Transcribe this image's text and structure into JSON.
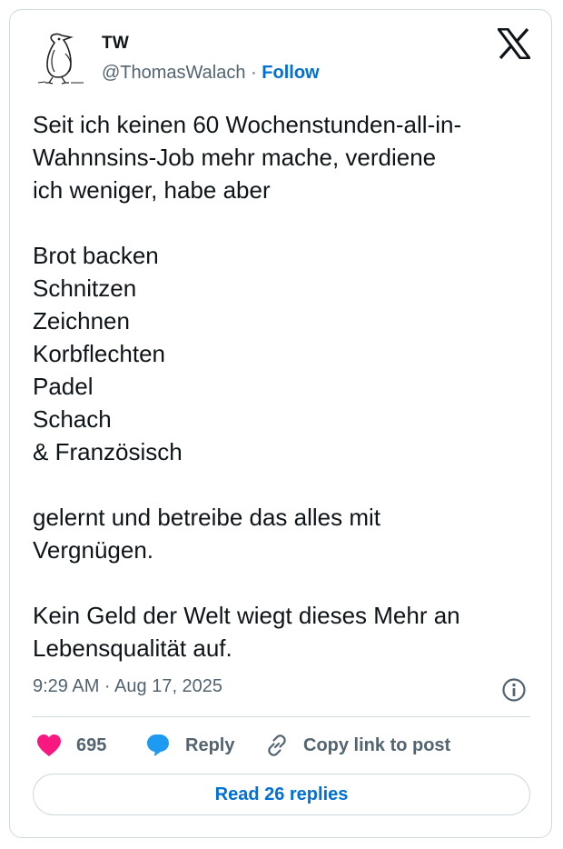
{
  "author": {
    "name": "TW",
    "handle": "@ThomasWalach",
    "separator": "·",
    "follow_label": "Follow",
    "avatar_icon": "penguin-sketch-avatar-icon"
  },
  "logo_icon": "x-logo-icon",
  "tweet": {
    "text": "Seit ich keinen 60 Wochenstunden-all-in-\nWahnnsins-Job mehr mache, verdiene\nich weniger, habe aber\n\nBrot backen\nSchnitzen\nZeichnen\nKorbflechten\nPadel\nSchach\n& Französisch\n\ngelernt und betreibe das alles mit\nVergnügen.\n\nKein Geld der Welt wiegt dieses Mehr an\nLebensqualität auf.",
    "timestamp": "9:29 AM · Aug 17, 2025"
  },
  "actions": {
    "likes_count": "695",
    "reply_label": "Reply",
    "copy_label": "Copy link to post",
    "read_replies_label": "Read 26 replies"
  },
  "colors": {
    "accent": "#006fd6",
    "heart": "#f91880",
    "reply_bubble": "#1d9bf0",
    "muted_text": "#536471",
    "border": "#cfd9de"
  }
}
